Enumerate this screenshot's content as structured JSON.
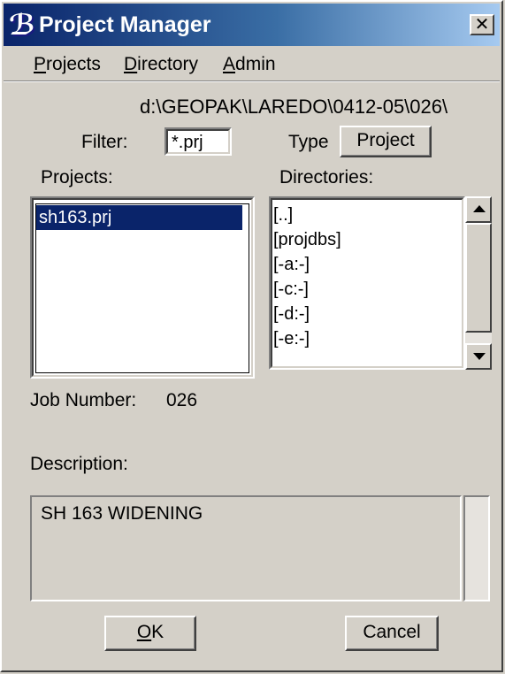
{
  "window": {
    "title": "Project Manager",
    "icon": "bentley-b-icon",
    "close_glyph": "✕"
  },
  "menu": {
    "items": [
      {
        "label_underlined": "P",
        "label_rest": "rojects"
      },
      {
        "label_underlined": "D",
        "label_rest": "irectory"
      },
      {
        "label_underlined": "A",
        "label_rest": "dmin"
      }
    ]
  },
  "path": "d:\\GEOPAK\\LAREDO\\0412-05\\026\\",
  "filter": {
    "label": "Filter:",
    "value": "*.prj"
  },
  "type": {
    "label": "Type",
    "button": "Project"
  },
  "projects": {
    "label": "Projects:",
    "items": [
      "sh163.prj"
    ],
    "selected_index": 0
  },
  "directories": {
    "label": "Directories:",
    "items": [
      "[..]",
      "[projdbs]",
      "[-a:-]",
      "[-c:-]",
      "[-d:-]",
      "[-e:-]"
    ]
  },
  "job": {
    "label": "Job Number:",
    "value": "026"
  },
  "description": {
    "label": "Description:",
    "value": "SH 163 WIDENING"
  },
  "buttons": {
    "ok_underlined": "O",
    "ok_rest": "K",
    "cancel": "Cancel"
  },
  "colors": {
    "selection": "#0a246a",
    "titlebar_start": "#0a246a",
    "titlebar_end": "#a6caf0",
    "face": "#d4d0c8"
  }
}
